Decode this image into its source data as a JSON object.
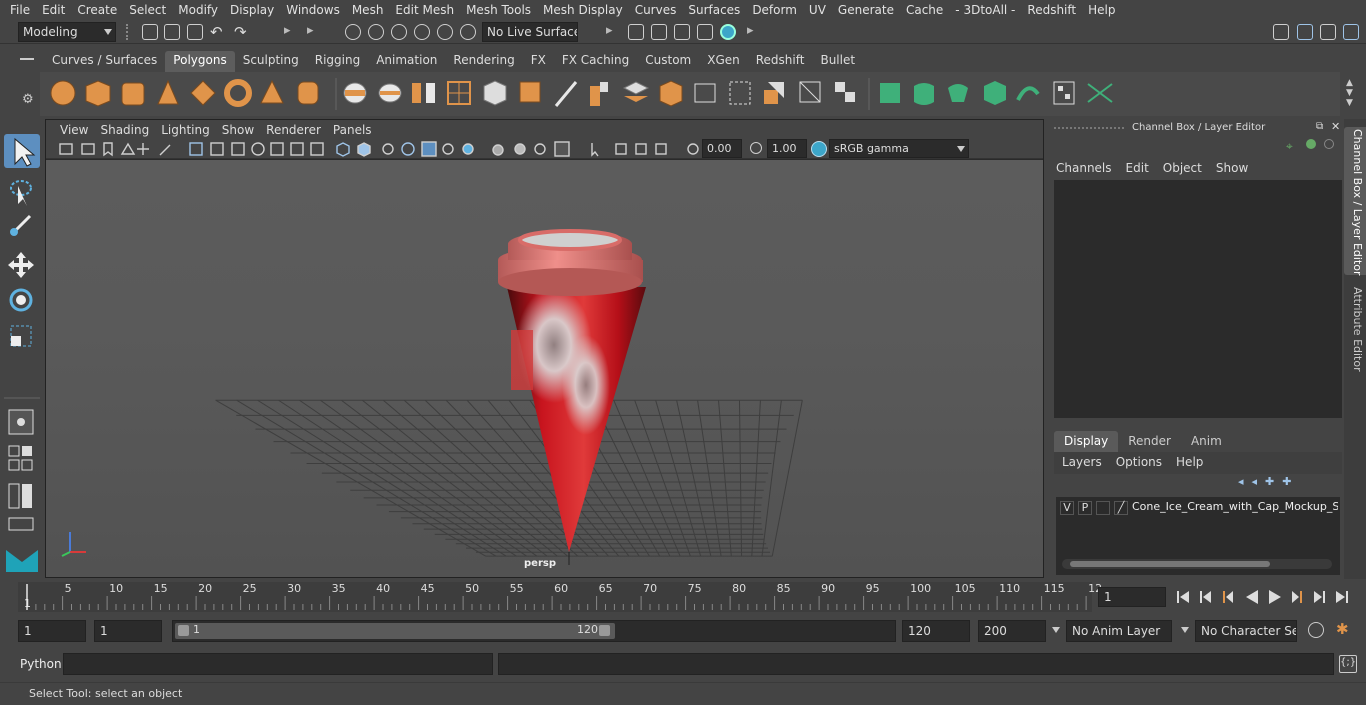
{
  "menu": [
    "File",
    "Edit",
    "Create",
    "Select",
    "Modify",
    "Display",
    "Windows",
    "Mesh",
    "Edit Mesh",
    "Mesh Tools",
    "Mesh Display",
    "Curves",
    "Surfaces",
    "Deform",
    "UV",
    "Generate",
    "Cache",
    "- 3DtoAll -",
    "Redshift",
    "Help"
  ],
  "status": {
    "mode": "Modeling",
    "live_surface": "No Live Surface"
  },
  "shelf_tabs": [
    "Curves / Surfaces",
    "Polygons",
    "Sculpting",
    "Rigging",
    "Animation",
    "Rendering",
    "FX",
    "FX Caching",
    "Custom",
    "XGen",
    "Redshift",
    "Bullet"
  ],
  "active_shelf_tab": "Polygons",
  "viewport": {
    "menu": [
      "View",
      "Shading",
      "Lighting",
      "Show",
      "Renderer",
      "Panels"
    ],
    "exposure": "0.00",
    "gamma": "1.00",
    "color_space": "sRGB gamma",
    "camera_label": "persp"
  },
  "channel_box": {
    "title": "Channel Box / Layer Editor",
    "menu": [
      "Channels",
      "Edit",
      "Object",
      "Show"
    ]
  },
  "layer_editor": {
    "tabs": [
      "Display",
      "Render",
      "Anim"
    ],
    "active_tab": "Display",
    "menu": [
      "Layers",
      "Options",
      "Help"
    ],
    "layer": {
      "v": "V",
      "p": "P",
      "name": "Cone_Ice_Cream_with_Cap_Mockup_Stra"
    }
  },
  "side_tabs": [
    "Channel Box / Layer Editor",
    "Attribute Editor"
  ],
  "timeline": {
    "ticks": [
      "5",
      "10",
      "15",
      "20",
      "25",
      "30",
      "35",
      "40",
      "45",
      "50",
      "55",
      "60",
      "65",
      "70",
      "75",
      "80",
      "85",
      "90",
      "95",
      "100",
      "105",
      "110",
      "115",
      "12"
    ],
    "start_label": "1",
    "current_frame": "1"
  },
  "range": {
    "start": "1",
    "playback_start": "1",
    "slider_start": "1",
    "slider_end": "120",
    "playback_end": "120",
    "end": "200",
    "anim_layer": "No Anim Layer",
    "character_set": "No Character Set"
  },
  "cmd": {
    "label": "Python"
  },
  "help_text": "Select Tool: select an object",
  "colors": {
    "cone_red": "#c8141e",
    "cap_pink": "#e07a76",
    "grid": "#3e3e3e",
    "accent_blue": "#5d8fc0"
  }
}
